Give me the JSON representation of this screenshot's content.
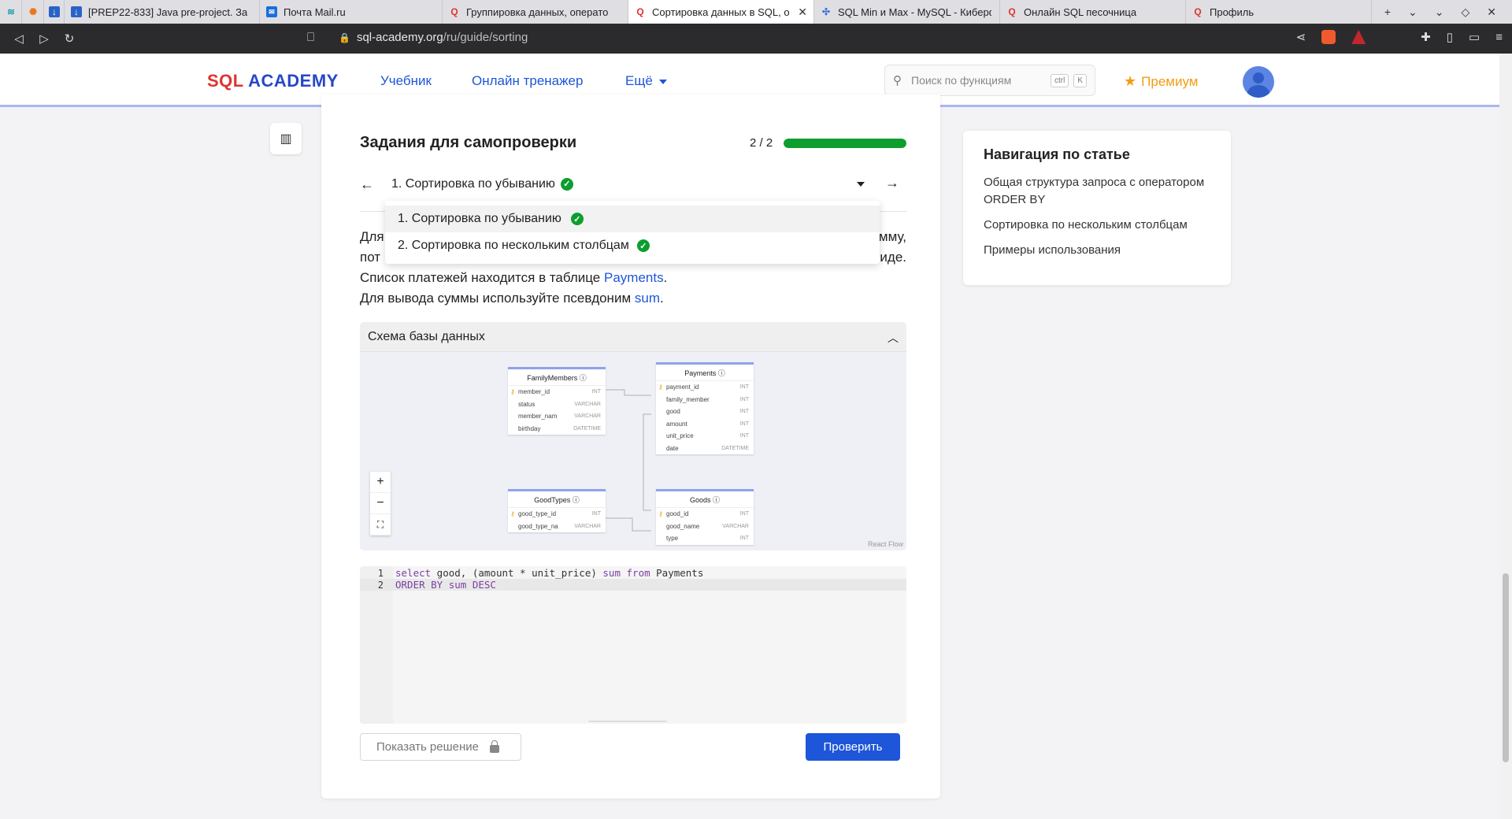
{
  "browser": {
    "tabs": [
      {
        "title": "",
        "icon": "app-icon"
      },
      {
        "title": "",
        "icon": "brave-icon"
      },
      {
        "title": "",
        "icon": "download-icon"
      },
      {
        "title": "[PREP22-833] Java pre-project. За",
        "icon": "download-icon"
      },
      {
        "title": "Почта Mail.ru",
        "icon": "mail-icon"
      },
      {
        "title": "Группировка данных, операто",
        "icon": "sql-academy-icon"
      },
      {
        "title": "Сортировка данных в SQL, о",
        "icon": "sql-academy-icon",
        "active": true
      },
      {
        "title": "SQL Min и Max - MySQL - Киберф",
        "icon": "cyber-icon"
      },
      {
        "title": "Онлайн SQL песочница",
        "icon": "sql-academy-icon"
      },
      {
        "title": "Профиль",
        "icon": "sql-academy-icon"
      }
    ],
    "url_host": "sql-academy.org",
    "url_path": "/ru/guide/sorting"
  },
  "header": {
    "logo_sql": "SQL",
    "logo_academy": "ACADEMY",
    "menu": [
      "Учебник",
      "Онлайн тренажер",
      "Ещё"
    ],
    "search_placeholder": "Поиск по функциям",
    "search_kbd": [
      "ctrl",
      "K"
    ],
    "premium": "Премиум"
  },
  "task": {
    "title": "Задания для самопроверки",
    "progress_label": "2 / 2",
    "progress_fraction": 1.0,
    "current": "1. Сортировка по убыванию",
    "dropdown_items": [
      "1. Сортировка по убыванию",
      "2. Сортировка по нескольким столбцам"
    ],
    "desc_line1_left": "Для",
    "desc_line1_right": "мму,",
    "desc_line2_left": "пот",
    "desc_line2_right": "иде.",
    "desc_line3_text": "Список платежей находится в таблице ",
    "desc_line3_link": "Payments",
    "desc_line4_text": "Для вывода суммы используйте псевдоним ",
    "desc_line4_link": "sum"
  },
  "schema": {
    "title": "Схема базы данных",
    "attribution": "React Flow",
    "tables": [
      {
        "name": "FamilyMembers",
        "cols": [
          [
            "member_id",
            "INT"
          ],
          [
            "status",
            "VARCHAR"
          ],
          [
            "member_nam",
            "VARCHAR"
          ],
          [
            "birthday",
            "DATETIME"
          ]
        ]
      },
      {
        "name": "Payments",
        "cols": [
          [
            "payment_id",
            "INT"
          ],
          [
            "family_member",
            "INT"
          ],
          [
            "good",
            "INT"
          ],
          [
            "amount",
            "INT"
          ],
          [
            "unit_price",
            "INT"
          ],
          [
            "date",
            "DATETIME"
          ]
        ]
      },
      {
        "name": "GoodTypes",
        "cols": [
          [
            "good_type_id",
            "INT"
          ],
          [
            "good_type_na",
            "VARCHAR"
          ]
        ]
      },
      {
        "name": "Goods",
        "cols": [
          [
            "good_id",
            "INT"
          ],
          [
            "good_name",
            "VARCHAR"
          ],
          [
            "type",
            "INT"
          ]
        ]
      }
    ]
  },
  "editor": {
    "lines": [
      {
        "n": "1",
        "parts": [
          [
            "kw",
            "select"
          ],
          [
            "",
            " good, (amount * unit_price) "
          ],
          [
            "kw",
            "sum"
          ],
          [
            "",
            " "
          ],
          [
            "kw",
            "from"
          ],
          [
            "",
            " Payments"
          ]
        ]
      },
      {
        "n": "2",
        "parts": [
          [
            "kw",
            "ORDER BY"
          ],
          [
            "",
            " "
          ],
          [
            "kw",
            "sum"
          ],
          [
            "",
            " "
          ],
          [
            "kw",
            "DESC"
          ]
        ]
      }
    ]
  },
  "buttons": {
    "show_solution": "Показать решение",
    "check": "Проверить"
  },
  "article_nav": {
    "title": "Навигация по статье",
    "items": [
      "Общая структура запроса с оператором ORDER BY",
      "Сортировка по нескольким столбцам",
      "Примеры использования"
    ]
  },
  "colors": {
    "accent": "#1d56d8",
    "success": "#0d9e2e",
    "premium": "#f39c12",
    "logo_red": "#e0332f"
  }
}
